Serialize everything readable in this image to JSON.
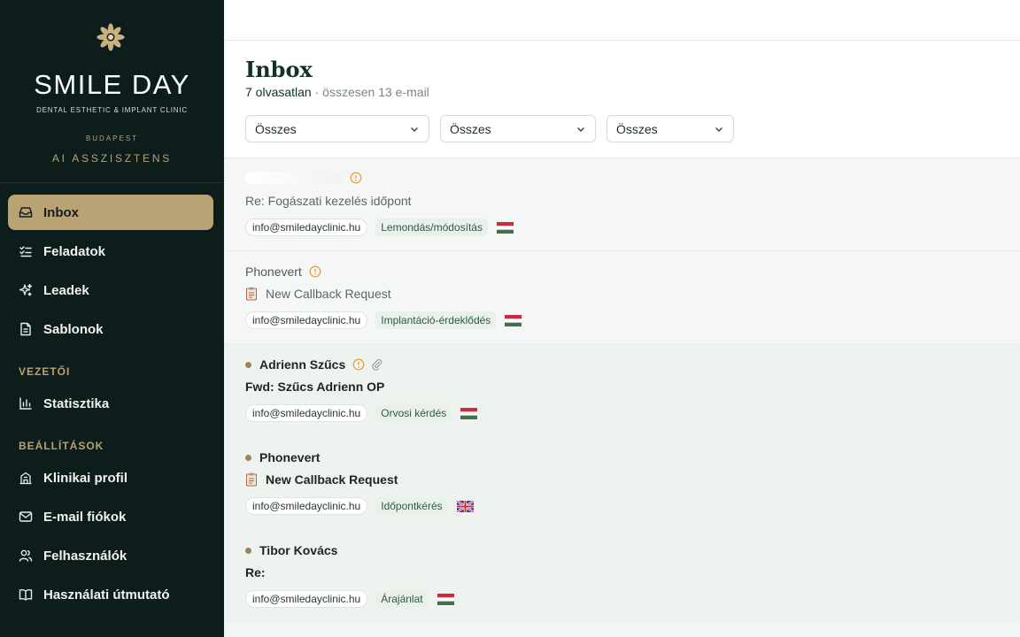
{
  "brand": {
    "name": "SMILE DAY",
    "subtitle": "DENTAL ESTHETIC & IMPLANT CLINIC",
    "city": "BUDAPEST",
    "app": "AI ASSZISZTENS",
    "accent": "#b9a274",
    "sidebar_bg": "#0c1d1c"
  },
  "nav": {
    "main": [
      {
        "label": "Inbox",
        "icon": "inbox-icon",
        "active": true
      },
      {
        "label": "Feladatok",
        "icon": "checklist-icon"
      },
      {
        "label": "Leadek",
        "icon": "sparkles-icon"
      },
      {
        "label": "Sablonok",
        "icon": "document-icon"
      }
    ],
    "section_manager": "VEZETŐI",
    "manager": [
      {
        "label": "Statisztika",
        "icon": "bar-chart-icon"
      }
    ],
    "section_settings": "BEÁLLÍTÁSOK",
    "settings": [
      {
        "label": "Klinikai profil",
        "icon": "building-icon"
      },
      {
        "label": "E-mail fiókok",
        "icon": "mail-icon"
      },
      {
        "label": "Felhasználók",
        "icon": "users-icon"
      },
      {
        "label": "Használati útmutató",
        "icon": "book-icon"
      }
    ]
  },
  "header": {
    "title": "Inbox",
    "unread": "7 olvasatlan",
    "separator": " · ",
    "total": "összesen 13 e-mail",
    "filters": [
      "Összes",
      "Összes",
      "Összes"
    ]
  },
  "emails": [
    {
      "sender": "",
      "subject": "Re: Fogászati kezelés időpont",
      "account": "info@smiledayclinic.hu",
      "category": "Lemondás/módosítás",
      "flag": "hu",
      "unread": false,
      "warning": true,
      "attachment": false,
      "clipboard": false
    },
    {
      "sender": "Phonevert",
      "subject": "New Callback Request",
      "account": "info@smiledayclinic.hu",
      "category": "Implantáció-érdeklődés",
      "flag": "hu",
      "unread": false,
      "warning": true,
      "attachment": false,
      "clipboard": true
    },
    {
      "sender": "Adrienn Szűcs",
      "subject": "Fwd: Szűcs Adrienn OP",
      "account": "info@smiledayclinic.hu",
      "category": "Orvosi kérdés",
      "flag": "hu",
      "unread": true,
      "warning": true,
      "attachment": true,
      "clipboard": false
    },
    {
      "sender": "Phonevert",
      "subject": "New Callback Request",
      "account": "info@smiledayclinic.hu",
      "category": "Időpontkérés",
      "flag": "gb",
      "unread": true,
      "warning": false,
      "attachment": false,
      "clipboard": true
    },
    {
      "sender": "Tibor Kovács",
      "subject": "Re:",
      "account": "info@smiledayclinic.hu",
      "category": "Árajánlat",
      "flag": "hu",
      "unread": true,
      "warning": false,
      "attachment": false,
      "clipboard": false
    }
  ]
}
